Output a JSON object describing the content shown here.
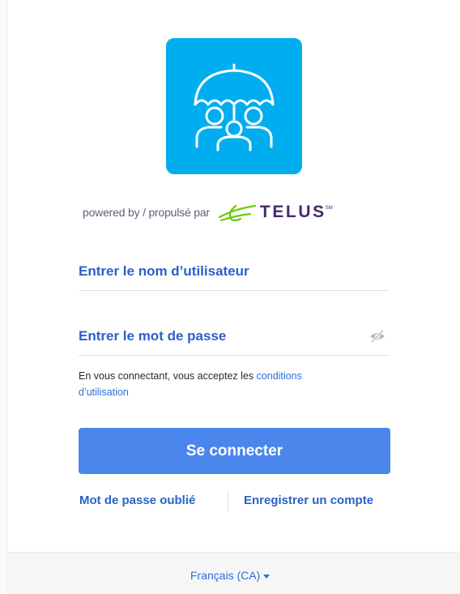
{
  "branding": {
    "app_logo_icon": "family-umbrella-icon",
    "logo_color": "#00aeef",
    "powered_by": "powered by / propulsé par",
    "partner_logo_icon": "telus-leaf-icon",
    "partner_name": "TELUS",
    "partner_mark": "SM",
    "partner_color": "#4b286d",
    "partner_leaf_color": "#66cc00"
  },
  "form": {
    "username_placeholder": "Entrer le nom d’utilisateur",
    "password_placeholder": "Entrer le mot de passe",
    "password_toggle_icon": "eye-slash-icon",
    "terms_prefix": "En vous connectant, vous acceptez les",
    "terms_link": "conditions d’utilisation",
    "submit_label": "Se connecter",
    "accent_color": "#4a86ec"
  },
  "links": {
    "forgot_password": "Mot de passe oublié",
    "register": "Enregistrer un compte"
  },
  "footer": {
    "language": "Français (CA)",
    "language_caret_icon": "caret-down-icon"
  }
}
